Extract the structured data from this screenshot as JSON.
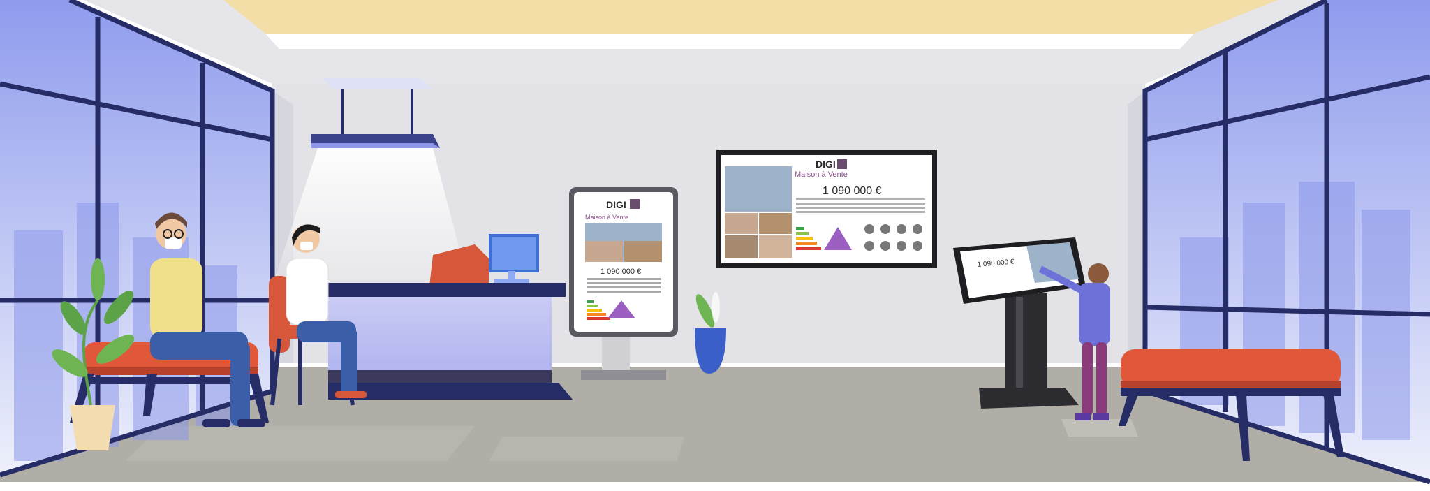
{
  "scene": {
    "description_colors": {
      "ceiling_accent": "#f2dea6",
      "wall": "#e3e3e7",
      "floor": "#b0aea6",
      "window_sky": "#9aa6ef",
      "frame": "#262c66",
      "bench": "#e0573a"
    }
  },
  "poster": {
    "brand": "DIGI",
    "subtitle": "Maison à Vente",
    "price": "1 090 000 €"
  },
  "tv": {
    "brand": "DIGI",
    "subtitle": "Maison à Vente",
    "price": "1 090 000 €"
  },
  "kiosk": {
    "price": "1 090 000 €"
  }
}
